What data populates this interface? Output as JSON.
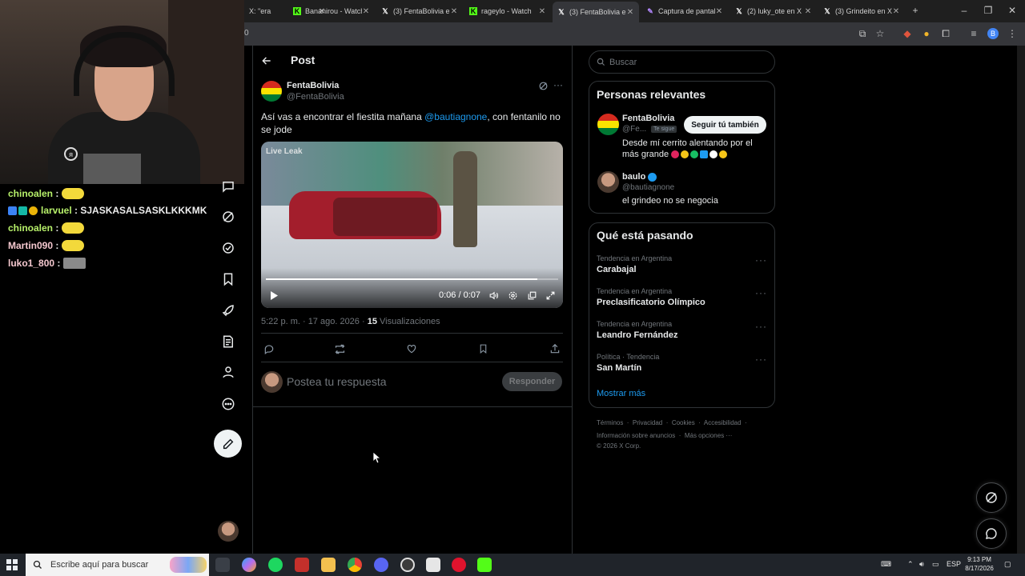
{
  "browser": {
    "tabs": [
      {
        "title": "X: \"era",
        "favicon": "x-icon",
        "active": false
      },
      {
        "title": "Bananirou - Watch",
        "favicon": "kick-icon",
        "active": false
      },
      {
        "title": "(3) FentaBolivia en",
        "favicon": "x-icon",
        "active": false
      },
      {
        "title": "rageylo - Watch",
        "favicon": "kick-icon",
        "active": false
      },
      {
        "title": "(3) FentaBolivia en",
        "favicon": "x-icon",
        "active": true
      },
      {
        "title": "Captura de pantalla",
        "favicon": "pen-icon",
        "active": false
      },
      {
        "title": "(2) luky_ote en X",
        "favicon": "x-icon",
        "active": false
      },
      {
        "title": "(3) Grindeito en X",
        "favicon": "x-icon",
        "active": false
      }
    ],
    "url_fragment": "0",
    "profile_initial": "B"
  },
  "stream": {
    "webcam_mark": "я",
    "chat": [
      {
        "user": "chinoalen",
        "message": "",
        "emote": "emote-yellow",
        "color": "green"
      },
      {
        "user": "larvuel",
        "message": "SJASKASALSASKLKKKMK",
        "emote": "",
        "color": "green",
        "badges": true
      },
      {
        "user": "chinoalen",
        "message": "",
        "emote": "emote-yellow",
        "color": "green"
      },
      {
        "user": "Martin090",
        "message": "",
        "emote": "emote-yellow",
        "color": "pink"
      },
      {
        "user": "luko1_800",
        "message": "",
        "emote": "emote-photo",
        "color": "pink"
      }
    ]
  },
  "header": {
    "title": "Post"
  },
  "post": {
    "author_name": "FentaBolivia",
    "author_handle": "@FentaBolivia",
    "text_before": "Así vas a encontrar el fiestita mañana ",
    "mention": "@bautiagnone",
    "text_after": ", con fentanilo no se jode",
    "video_watermark": "Live Leak",
    "video_time": "0:06 / 0:07",
    "video_progress": 0.93,
    "timestamp": "5:22 p. m. · 17 ago. 2026 · ",
    "views_count": "15",
    "views_label": " Visualizaciones"
  },
  "reply": {
    "placeholder": "Postea tu respuesta",
    "button": "Responder"
  },
  "sidebar": {
    "search_placeholder": "Buscar",
    "relevant_title": "Personas relevantes",
    "people": [
      {
        "name": "FentaBolivia",
        "handle": "@Fe...",
        "follows_you": "Te sigue",
        "bio": "Desde mí cerrito alentando por el más grande",
        "follow_label": "Seguir tú también"
      },
      {
        "name": "baulo",
        "handle": "@bautiagnone",
        "bio": "el grindeo no se negocia"
      }
    ],
    "trending_title": "Qué está pasando",
    "trends": [
      {
        "context": "Tendencia en Argentina",
        "name": "Carabajal"
      },
      {
        "context": "Tendencia en Argentina",
        "name": "Preclasificatorio Olímpico"
      },
      {
        "context": "Tendencia en Argentina",
        "name": "Leandro Fernández"
      },
      {
        "context": "Política · Tendencia",
        "name": "San Martín"
      }
    ],
    "show_more": "Mostrar más",
    "footer": {
      "line1": [
        "Términos",
        "Privacidad",
        "Cookies",
        "Accesibilidad"
      ],
      "line2": [
        "Información sobre anuncios",
        "Más opciones ···"
      ],
      "copyright": "© 2026 X Corp."
    }
  },
  "taskbar": {
    "search_placeholder": "Escribe aquí para buscar",
    "language": "ESP",
    "time": "9:13 PM",
    "date": "8/17/2026"
  },
  "colors": {
    "accent": "#1d9bf0",
    "background": "#000000",
    "border": "#2f3336",
    "muted_text": "#71767b"
  }
}
